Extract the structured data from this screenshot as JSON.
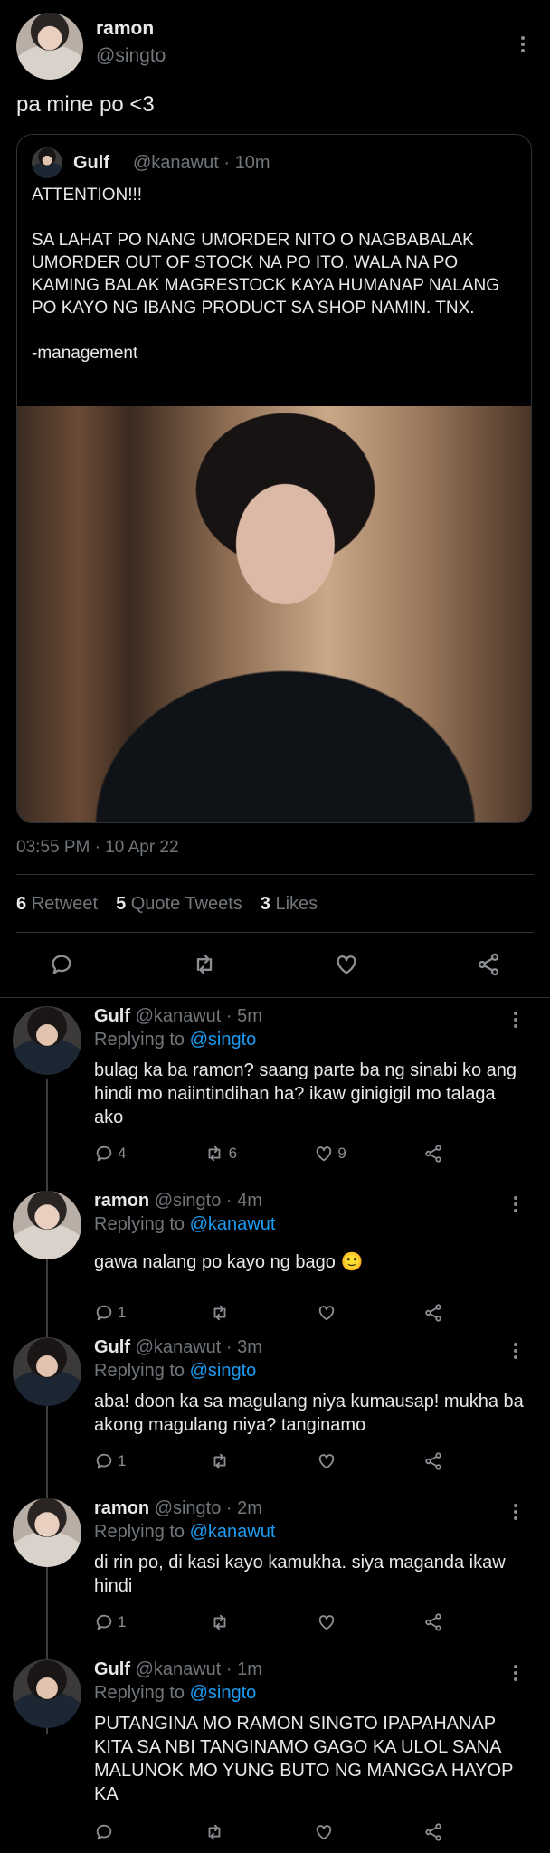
{
  "main_tweet": {
    "name": "ramon",
    "handle": "@singto",
    "text": "pa mine po <3",
    "timestamp": "03:55 PM · 10 Apr 22",
    "stats": {
      "retweets": "6",
      "retweets_label": "Retweet",
      "quotes": "5",
      "quotes_label": "Quote Tweets",
      "likes": "3",
      "likes_label": "Likes"
    }
  },
  "quoted_tweet": {
    "name": "Gulf",
    "meta": "@kanawut · 10m",
    "paragraphs": [
      "ATTENTION!!!",
      "SA LAHAT PO NANG UMORDER NITO O NAGBABALAK UMORDER OUT OF STOCK NA PO ITO. WALA NA PO KAMING BALAK MAGRESTOCK KAYA HUMANAP NALANG PO KAYO NG IBANG PRODUCT SA SHOP NAMIN. TNX.",
      "-management"
    ]
  },
  "replies": [
    {
      "name": "Gulf",
      "meta": "@kanawut · 5m",
      "replying_label": "Replying to",
      "replying_to": "@singto",
      "text": "bulag ka ba ramon? saang parte ba ng sinabi ko ang hindi mo naiintindihan ha? ikaw ginigigil mo talaga ako",
      "replies_count": "4",
      "retweets_count": "6",
      "likes_count": "9"
    },
    {
      "name": "ramon",
      "meta": "@singto · 4m",
      "replying_label": "Replying to",
      "replying_to": "@kanawut",
      "text": "gawa nalang po kayo ng bago 🙂",
      "replies_count": "1",
      "retweets_count": "",
      "likes_count": ""
    },
    {
      "name": "Gulf",
      "meta": "@kanawut · 3m",
      "replying_label": "Replying to",
      "replying_to": "@singto",
      "text": "aba! doon ka sa magulang niya kumausap! mukha ba akong magulang niya? tanginamo",
      "replies_count": "1",
      "retweets_count": "",
      "likes_count": ""
    },
    {
      "name": "ramon",
      "meta": "@singto · 2m",
      "replying_label": "Replying to",
      "replying_to": "@kanawut",
      "text": "di rin po, di kasi kayo kamukha. siya maganda ikaw hindi",
      "replies_count": "1",
      "retweets_count": "",
      "likes_count": ""
    },
    {
      "name": "Gulf",
      "meta": "@kanawut · 1m",
      "replying_label": "Replying to",
      "replying_to": "@singto",
      "text": "PUTANGINA MO RAMON SINGTO IPAPAHANAP KITA SA NBI TANGINAMO GAGO KA ULOL SANA MALUNOK MO YUNG BUTO NG MANGGA HAYOP KA",
      "replies_count": "",
      "retweets_count": "",
      "likes_count": ""
    }
  ],
  "icons": {
    "reply": "reply-icon",
    "retweet": "retweet-icon",
    "like": "heart-icon",
    "share": "share-icon",
    "more": "more-icon"
  }
}
